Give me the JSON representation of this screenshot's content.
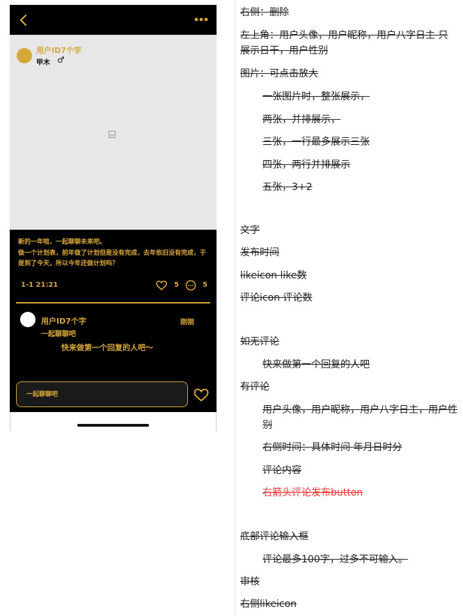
{
  "post": {
    "nickname": "用户ID7个字",
    "day_name": "甲木",
    "gender_symbol": "♂",
    "caption_lines": [
      "新的一年啦，一起聊聊未来吧。",
      "做一个计划表，前年做了计划但是没有完成，去年依旧没有完成，于是到了今天，所以今年还做计划吗？"
    ],
    "post_time": "1-1 21:21",
    "like_count": "5",
    "comment_count": "5"
  },
  "comment": {
    "nickname": "用户ID7个字",
    "time": "刚刚",
    "text": "一起聊聊吧",
    "empty_hint": "快来做第一个回复的人吧～"
  },
  "input": {
    "placeholder": "一起聊聊吧"
  },
  "colors": {
    "accent": "#d7a73a",
    "background": "#000000",
    "photo_bg": "#e7e7e7",
    "note_red": "#e33333"
  },
  "notes": [
    "右侧：删除",
    "左上角：用户头像，用户昵称，用户八字日主 只展示日干，用户性别",
    "图片：可点击放大",
    "一张图片时，整张展示，",
    "两张，并排展示，",
    "三张，一行最多展示三张",
    "四张，两行并排展示",
    "五张，3+2",
    "文字",
    "发布时间",
    "likeicon like数",
    "评论icon 评论数",
    "如无评论",
    "快来做第一个回复的人吧",
    "有评论",
    "用户头像，用户昵称，用户八字日主，用户性别",
    "右侧时间：具体时间 年月日时分",
    "评论内容",
    "右箭头评论发布button",
    "底部评论输入框",
    "评论最多100字，过多不可输入。",
    "审核",
    "右侧likeicon"
  ]
}
